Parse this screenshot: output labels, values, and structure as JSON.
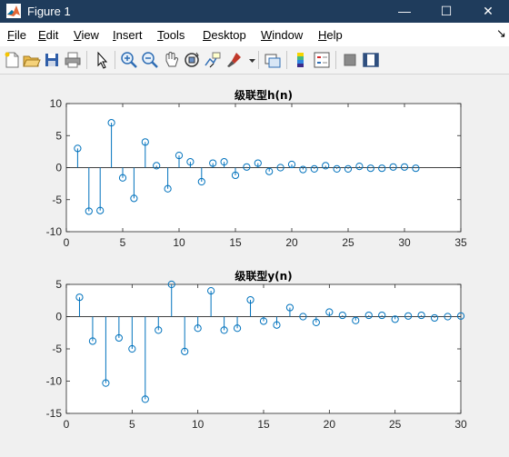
{
  "window": {
    "title": "Figure 1",
    "minimize_glyph": "—",
    "maximize_glyph": "☐",
    "close_glyph": "✕"
  },
  "menubar": {
    "items": [
      {
        "label": "File",
        "mnemonic": "F"
      },
      {
        "label": "Edit",
        "mnemonic": "E"
      },
      {
        "label": "View",
        "mnemonic": "V"
      },
      {
        "label": "Insert",
        "mnemonic": "I"
      },
      {
        "label": "Tools",
        "mnemonic": "T"
      },
      {
        "label": "Desktop",
        "mnemonic": "D"
      },
      {
        "label": "Window",
        "mnemonic": "W"
      },
      {
        "label": "Help",
        "mnemonic": "H"
      }
    ],
    "dock_glyph": "↘"
  },
  "toolbar": {
    "icons": [
      "new-figure-icon",
      "open-file-icon",
      "save-icon",
      "print-icon",
      "pointer-icon",
      "zoom-in-icon",
      "zoom-out-icon",
      "pan-icon",
      "rotate-3d-icon",
      "data-cursor-icon",
      "brush-icon",
      "link-plot-icon",
      "colorbar-icon",
      "legend-icon",
      "hide-plot-tools-icon",
      "show-plot-tools-icon"
    ]
  },
  "colors": {
    "stem": "#0072bd",
    "titlebar": "#1f3c5c",
    "axes_bg": "#ffffff"
  },
  "chart_data": [
    {
      "type": "stem",
      "title": "级联型h(n)",
      "xlim": [
        0,
        35
      ],
      "ylim": [
        -10,
        10
      ],
      "xticks": [
        0,
        5,
        10,
        15,
        20,
        25,
        30,
        35
      ],
      "yticks": [
        -10,
        -5,
        0,
        5,
        10
      ],
      "x": [
        1,
        2,
        3,
        4,
        5,
        6,
        7,
        8,
        9,
        10,
        11,
        12,
        13,
        14,
        15,
        16,
        17,
        18,
        19,
        20,
        21,
        22,
        23,
        24,
        25,
        26,
        27,
        28,
        29,
        30,
        31
      ],
      "values": [
        3.0,
        -6.8,
        -6.7,
        7.0,
        -1.6,
        -4.8,
        4.0,
        0.3,
        -3.3,
        1.9,
        0.9,
        -2.2,
        0.7,
        0.9,
        -1.2,
        0.1,
        0.7,
        -0.6,
        0.0,
        0.5,
        -0.3,
        -0.2,
        0.3,
        -0.2,
        -0.2,
        0.2,
        -0.1,
        -0.1,
        0.1,
        0.1,
        -0.1
      ]
    },
    {
      "type": "stem",
      "title": "级联型y(n)",
      "xlim": [
        0,
        30
      ],
      "ylim": [
        -15,
        5
      ],
      "xticks": [
        0,
        5,
        10,
        15,
        20,
        25,
        30
      ],
      "yticks": [
        -15,
        -10,
        -5,
        0,
        5
      ],
      "x": [
        1,
        2,
        3,
        4,
        5,
        6,
        7,
        8,
        9,
        10,
        11,
        12,
        13,
        14,
        15,
        16,
        17,
        18,
        19,
        20,
        21,
        22,
        23,
        24,
        25,
        26,
        27,
        28,
        29,
        30
      ],
      "values": [
        3.0,
        -3.8,
        -10.3,
        -3.3,
        -5.0,
        -12.8,
        -2.1,
        5.0,
        -5.4,
        -1.8,
        4.0,
        -2.1,
        -1.8,
        2.6,
        -0.7,
        -1.3,
        1.4,
        0.0,
        -0.9,
        0.7,
        0.2,
        -0.6,
        0.2,
        0.2,
        -0.4,
        0.1,
        0.2,
        -0.2,
        0.0,
        0.1
      ]
    }
  ]
}
